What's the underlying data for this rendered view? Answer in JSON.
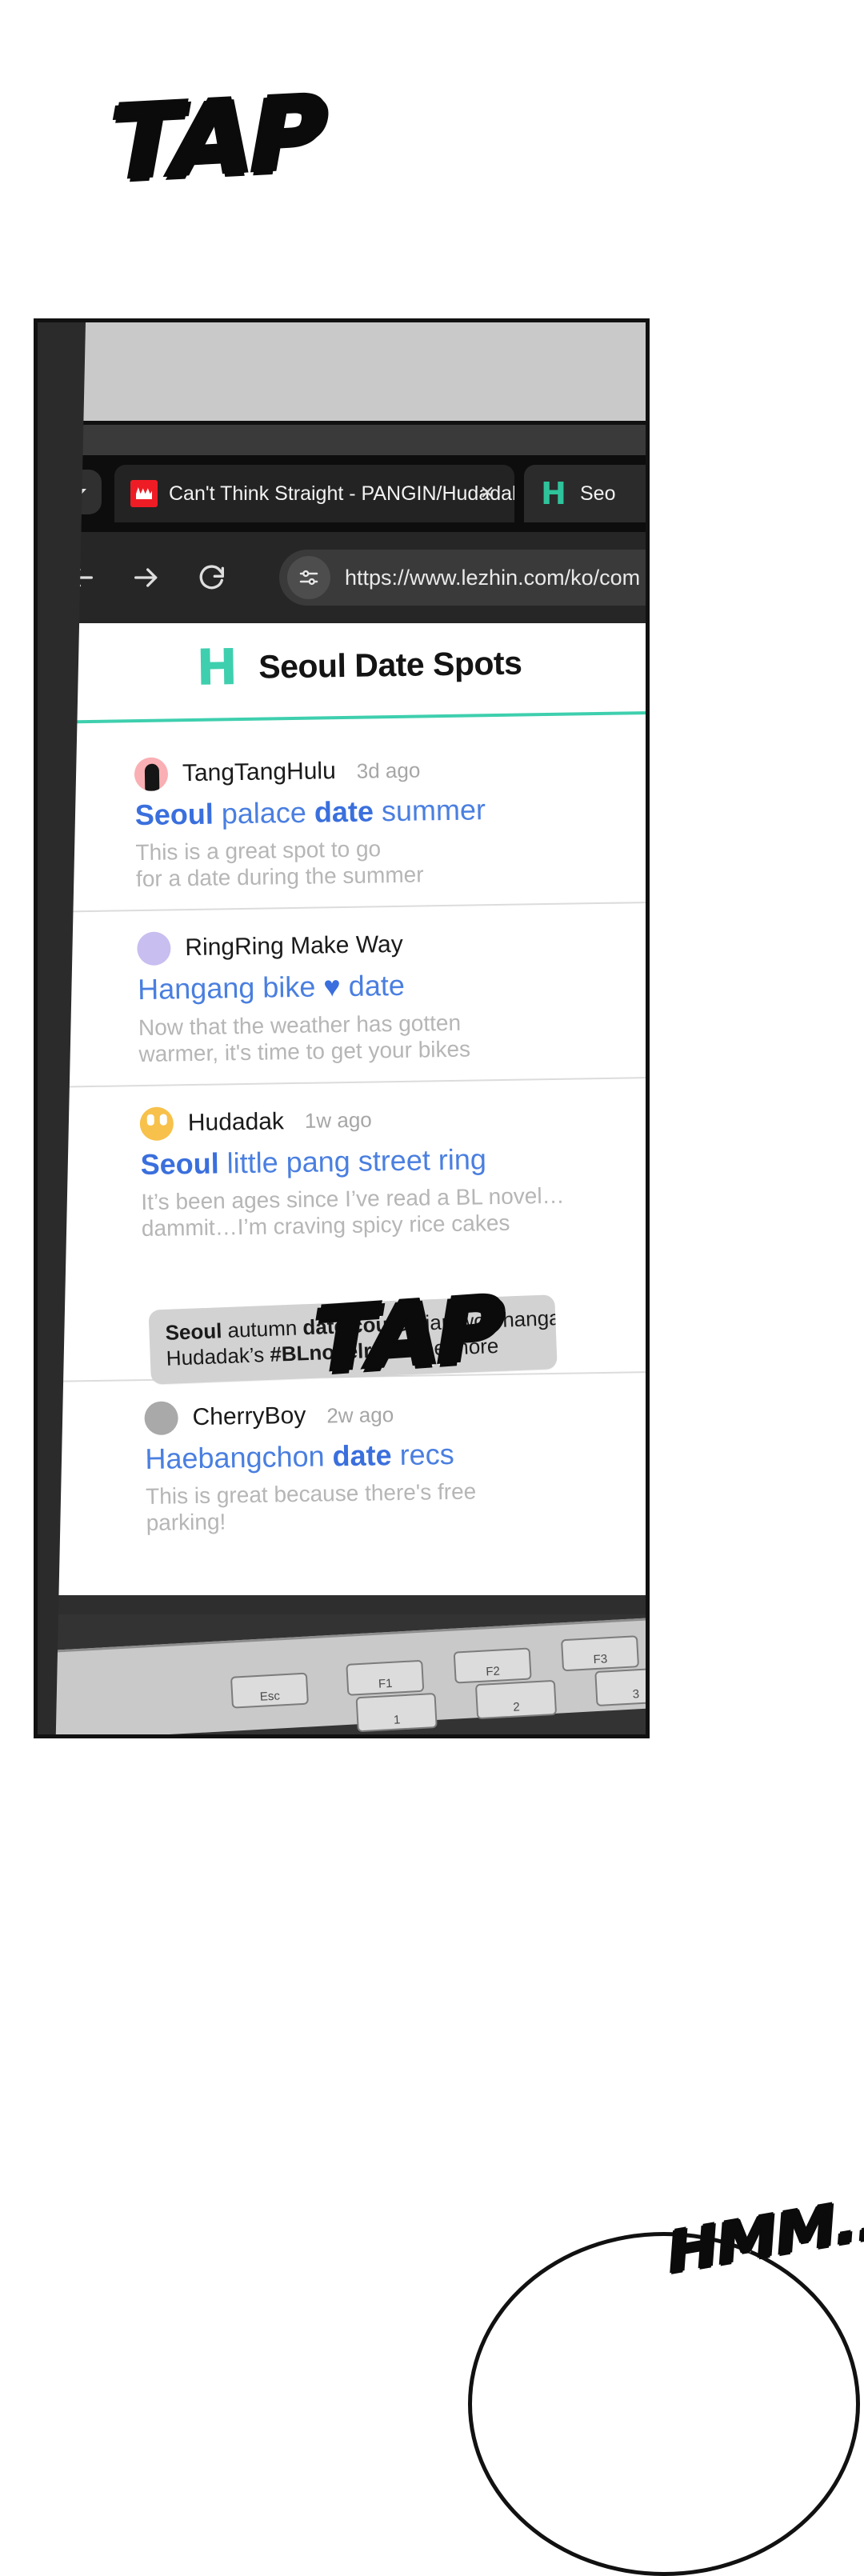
{
  "sfx": {
    "tap_top": "TAP",
    "tap_bottom": "TAP",
    "hmm": "HMM..."
  },
  "browser": {
    "tab_list_icon": "chevron-down-icon",
    "tabs": [
      {
        "favicon": "lezhin-favicon",
        "title": "Can't Think Straight - PANGIN/Hudadak",
        "close_label": "×",
        "active": true
      },
      {
        "favicon": "site-h-logo",
        "title": "Seo",
        "active": false
      }
    ],
    "toolbar": {
      "back_icon": "arrow-left-icon",
      "forward_icon": "arrow-right-icon",
      "reload_icon": "reload-icon",
      "site_settings_icon": "site-settings-icon",
      "url": "https://www.lezhin.com/ko/com"
    }
  },
  "page": {
    "logo": "H",
    "title": "Seoul Date Spots",
    "accent_color": "#3ecfae",
    "link_color": "#4a7fe0",
    "posts": [
      {
        "avatar": "pink",
        "user": "TangTangHulu",
        "time": "3d ago",
        "title_parts": [
          {
            "text": "Seoul ",
            "bold": true
          },
          {
            "text": "palace ",
            "bold": false
          },
          {
            "text": "date ",
            "bold": true
          },
          {
            "text": "summer",
            "bold": false
          }
        ],
        "body_lines": [
          "This is a great spot to go",
          "for a date during the summer"
        ]
      },
      {
        "avatar": "purple",
        "user": "RingRing Make Way",
        "time": "",
        "title_parts": [
          {
            "text": "Hangang bike ",
            "bold": false
          },
          {
            "text": "♥ ",
            "bold": true
          },
          {
            "text": "date",
            "bold": false
          }
        ],
        "body_lines": [
          "Now that the weather has gotten",
          "warmer, it's time to get your bikes"
        ]
      },
      {
        "avatar": "yellow",
        "user": "Hudadak",
        "time": "1w ago",
        "title_parts": [
          {
            "text": "Seoul ",
            "bold": true
          },
          {
            "text": "little pang street ring",
            "bold": false
          }
        ],
        "body_lines": [
          "It’s been ages since I’ve read a BL novel…",
          "dammit…I’m craving spicy rice cakes"
        ]
      },
      {
        "avatar": "gray",
        "user": "CherryBoy",
        "time": "2w ago",
        "title_parts": [
          {
            "text": "Haebangchon ",
            "bold": false
          },
          {
            "text": "date ",
            "bold": true
          },
          {
            "text": "recs",
            "bold": false
          }
        ],
        "body_lines": [
          "This is great because there's free",
          "parking!"
        ]
      }
    ],
    "tooltip": {
      "line1_parts": [
        {
          "text": "Seoul ",
          "bold": true
        },
        {
          "text": "autumn ",
          "bold": false
        },
        {
          "text": "date course ",
          "bold": true
        },
        {
          "text": "jamwon hangang",
          "bold": false
        }
      ],
      "line2_parts": [
        {
          "text": "Hudadak’s ",
          "bold": false
        },
        {
          "text": "#BLnovelrecs ",
          "bold": true
        },
        {
          "text": "see more",
          "bold": false
        }
      ]
    }
  },
  "keyboard": {
    "keys": [
      "Esc",
      "F1",
      "F2",
      "F3",
      "1",
      "2",
      "3"
    ]
  }
}
